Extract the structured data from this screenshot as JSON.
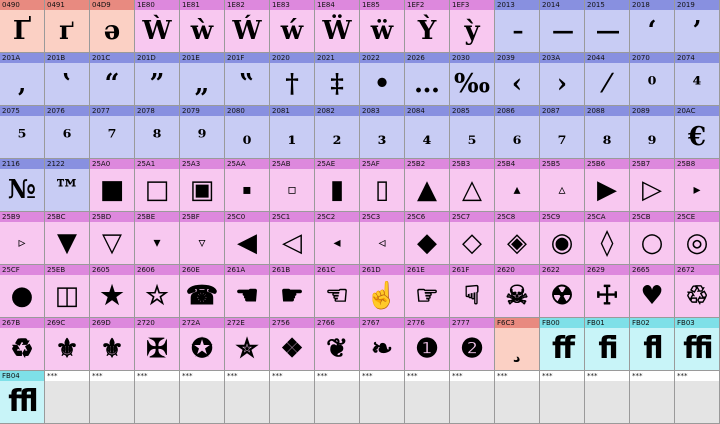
{
  "grid": {
    "cells": [
      {
        "code": "0490",
        "glyph": "Ґ",
        "cat": "cyrillic"
      },
      {
        "code": "0491",
        "glyph": "ґ",
        "cat": "cyrillic"
      },
      {
        "code": "04D9",
        "glyph": "ә",
        "cat": "cyrillic"
      },
      {
        "code": "1E80",
        "glyph": "Ẁ",
        "cat": "latin"
      },
      {
        "code": "1E81",
        "glyph": "ẁ",
        "cat": "latin"
      },
      {
        "code": "1E82",
        "glyph": "Ẃ",
        "cat": "latin"
      },
      {
        "code": "1E83",
        "glyph": "ẃ",
        "cat": "latin"
      },
      {
        "code": "1E84",
        "glyph": "Ẅ",
        "cat": "latin"
      },
      {
        "code": "1E85",
        "glyph": "ẅ",
        "cat": "latin"
      },
      {
        "code": "1EF2",
        "glyph": "Ỳ",
        "cat": "latin"
      },
      {
        "code": "1EF3",
        "glyph": "ỳ",
        "cat": "latin"
      },
      {
        "code": "2013",
        "glyph": "–",
        "cat": "punct"
      },
      {
        "code": "2014",
        "glyph": "—",
        "cat": "punct"
      },
      {
        "code": "2015",
        "glyph": "―",
        "cat": "punct"
      },
      {
        "code": "2018",
        "glyph": "‘",
        "cat": "punct"
      },
      {
        "code": "2019",
        "glyph": "’",
        "cat": "punct"
      },
      {
        "code": "201A",
        "glyph": "‚",
        "cat": "punct"
      },
      {
        "code": "201B",
        "glyph": "‛",
        "cat": "punct"
      },
      {
        "code": "201C",
        "glyph": "“",
        "cat": "punct"
      },
      {
        "code": "201D",
        "glyph": "”",
        "cat": "punct"
      },
      {
        "code": "201E",
        "glyph": "„",
        "cat": "punct"
      },
      {
        "code": "201F",
        "glyph": "‟",
        "cat": "punct"
      },
      {
        "code": "2020",
        "glyph": "†",
        "cat": "punct"
      },
      {
        "code": "2021",
        "glyph": "‡",
        "cat": "punct"
      },
      {
        "code": "2022",
        "glyph": "•",
        "cat": "punct"
      },
      {
        "code": "2026",
        "glyph": "…",
        "cat": "punct"
      },
      {
        "code": "2030",
        "glyph": "‰",
        "cat": "punct"
      },
      {
        "code": "2039",
        "glyph": "‹",
        "cat": "punct"
      },
      {
        "code": "203A",
        "glyph": "›",
        "cat": "punct"
      },
      {
        "code": "2044",
        "glyph": "⁄",
        "cat": "punct"
      },
      {
        "code": "2070",
        "glyph": "⁰",
        "cat": "punct"
      },
      {
        "code": "2074",
        "glyph": "⁴",
        "cat": "punct"
      },
      {
        "code": "2075",
        "glyph": "⁵",
        "cat": "punct"
      },
      {
        "code": "2076",
        "glyph": "⁶",
        "cat": "punct"
      },
      {
        "code": "2077",
        "glyph": "⁷",
        "cat": "punct"
      },
      {
        "code": "2078",
        "glyph": "⁸",
        "cat": "punct"
      },
      {
        "code": "2079",
        "glyph": "⁹",
        "cat": "punct"
      },
      {
        "code": "2080",
        "glyph": "₀",
        "cat": "punct"
      },
      {
        "code": "2081",
        "glyph": "₁",
        "cat": "punct"
      },
      {
        "code": "2082",
        "glyph": "₂",
        "cat": "punct"
      },
      {
        "code": "2083",
        "glyph": "₃",
        "cat": "punct"
      },
      {
        "code": "2084",
        "glyph": "₄",
        "cat": "punct"
      },
      {
        "code": "2085",
        "glyph": "₅",
        "cat": "punct"
      },
      {
        "code": "2086",
        "glyph": "₆",
        "cat": "punct"
      },
      {
        "code": "2087",
        "glyph": "₇",
        "cat": "punct"
      },
      {
        "code": "2088",
        "glyph": "₈",
        "cat": "punct"
      },
      {
        "code": "2089",
        "glyph": "₉",
        "cat": "punct"
      },
      {
        "code": "20AC",
        "glyph": "€",
        "cat": "punct"
      },
      {
        "code": "2116",
        "glyph": "№",
        "cat": "punct"
      },
      {
        "code": "2122",
        "glyph": "™",
        "cat": "punct"
      },
      {
        "code": "25A0",
        "glyph": "■",
        "cat": "symbol"
      },
      {
        "code": "25A1",
        "glyph": "□",
        "cat": "symbol"
      },
      {
        "code": "25A3",
        "glyph": "▣",
        "cat": "symbol"
      },
      {
        "code": "25AA",
        "glyph": "▪",
        "cat": "symbol"
      },
      {
        "code": "25AB",
        "glyph": "▫",
        "cat": "symbol"
      },
      {
        "code": "25AE",
        "glyph": "▮",
        "cat": "symbol"
      },
      {
        "code": "25AF",
        "glyph": "▯",
        "cat": "symbol"
      },
      {
        "code": "25B2",
        "glyph": "▲",
        "cat": "symbol"
      },
      {
        "code": "25B3",
        "glyph": "△",
        "cat": "symbol"
      },
      {
        "code": "25B4",
        "glyph": "▴",
        "cat": "symbol"
      },
      {
        "code": "25B5",
        "glyph": "▵",
        "cat": "symbol"
      },
      {
        "code": "25B6",
        "glyph": "▶",
        "cat": "symbol"
      },
      {
        "code": "25B7",
        "glyph": "▷",
        "cat": "symbol"
      },
      {
        "code": "25B8",
        "glyph": "▸",
        "cat": "symbol"
      },
      {
        "code": "25B9",
        "glyph": "▹",
        "cat": "symbol"
      },
      {
        "code": "25BC",
        "glyph": "▼",
        "cat": "symbol"
      },
      {
        "code": "25BD",
        "glyph": "▽",
        "cat": "symbol"
      },
      {
        "code": "25BE",
        "glyph": "▾",
        "cat": "symbol"
      },
      {
        "code": "25BF",
        "glyph": "▿",
        "cat": "symbol"
      },
      {
        "code": "25C0",
        "glyph": "◀",
        "cat": "symbol"
      },
      {
        "code": "25C1",
        "glyph": "◁",
        "cat": "symbol"
      },
      {
        "code": "25C2",
        "glyph": "◂",
        "cat": "symbol"
      },
      {
        "code": "25C3",
        "glyph": "◃",
        "cat": "symbol"
      },
      {
        "code": "25C6",
        "glyph": "◆",
        "cat": "symbol"
      },
      {
        "code": "25C7",
        "glyph": "◇",
        "cat": "symbol"
      },
      {
        "code": "25C8",
        "glyph": "◈",
        "cat": "symbol"
      },
      {
        "code": "25C9",
        "glyph": "◉",
        "cat": "symbol"
      },
      {
        "code": "25CA",
        "glyph": "◊",
        "cat": "symbol"
      },
      {
        "code": "25CB",
        "glyph": "○",
        "cat": "symbol"
      },
      {
        "code": "25CE",
        "glyph": "◎",
        "cat": "symbol"
      },
      {
        "code": "25CF",
        "glyph": "●",
        "cat": "symbol"
      },
      {
        "code": "25EB",
        "glyph": "◫",
        "cat": "symbol"
      },
      {
        "code": "2605",
        "glyph": "★",
        "cat": "symbol"
      },
      {
        "code": "2606",
        "glyph": "☆",
        "cat": "symbol"
      },
      {
        "code": "260E",
        "glyph": "☎",
        "cat": "symbol"
      },
      {
        "code": "261A",
        "glyph": "☚",
        "cat": "symbol"
      },
      {
        "code": "261B",
        "glyph": "☛",
        "cat": "symbol"
      },
      {
        "code": "261C",
        "glyph": "☜",
        "cat": "symbol"
      },
      {
        "code": "261D",
        "glyph": "☝",
        "cat": "symbol"
      },
      {
        "code": "261E",
        "glyph": "☞",
        "cat": "symbol"
      },
      {
        "code": "261F",
        "glyph": "☟",
        "cat": "symbol"
      },
      {
        "code": "2620",
        "glyph": "☠",
        "cat": "symbol"
      },
      {
        "code": "2622",
        "glyph": "☢",
        "cat": "symbol"
      },
      {
        "code": "2629",
        "glyph": "☩",
        "cat": "symbol"
      },
      {
        "code": "2665",
        "glyph": "♥",
        "cat": "symbol"
      },
      {
        "code": "2672",
        "glyph": "♲",
        "cat": "symbol"
      },
      {
        "code": "267B",
        "glyph": "♻",
        "cat": "symbol"
      },
      {
        "code": "269C",
        "glyph": "⚜",
        "cat": "symbol"
      },
      {
        "code": "269D",
        "glyph": "⚜",
        "cat": "symbol"
      },
      {
        "code": "2720",
        "glyph": "✠",
        "cat": "symbol"
      },
      {
        "code": "272A",
        "glyph": "✪",
        "cat": "symbol"
      },
      {
        "code": "272E",
        "glyph": "✮",
        "cat": "symbol"
      },
      {
        "code": "2756",
        "glyph": "❖",
        "cat": "symbol"
      },
      {
        "code": "2766",
        "glyph": "❦",
        "cat": "symbol"
      },
      {
        "code": "2767",
        "glyph": "❧",
        "cat": "symbol"
      },
      {
        "code": "2776",
        "glyph": "❶",
        "cat": "symbol"
      },
      {
        "code": "2777",
        "glyph": "❷",
        "cat": "symbol"
      },
      {
        "code": "F6C3",
        "glyph": "¸",
        "cat": "private"
      },
      {
        "code": "FB00",
        "glyph": "ff",
        "cat": "alpha"
      },
      {
        "code": "FB01",
        "glyph": "fi",
        "cat": "alpha"
      },
      {
        "code": "FB02",
        "glyph": "fl",
        "cat": "alpha"
      },
      {
        "code": "FB03",
        "glyph": "ffi",
        "cat": "alpha"
      },
      {
        "code": "FB04",
        "glyph": "ffl",
        "cat": "alpha"
      },
      {
        "code": "***",
        "glyph": "",
        "cat": "empty"
      },
      {
        "code": "***",
        "glyph": "",
        "cat": "empty"
      },
      {
        "code": "***",
        "glyph": "",
        "cat": "empty"
      },
      {
        "code": "***",
        "glyph": "",
        "cat": "empty"
      },
      {
        "code": "***",
        "glyph": "",
        "cat": "empty"
      },
      {
        "code": "***",
        "glyph": "",
        "cat": "empty"
      },
      {
        "code": "***",
        "glyph": "",
        "cat": "empty"
      },
      {
        "code": "***",
        "glyph": "",
        "cat": "empty"
      },
      {
        "code": "***",
        "glyph": "",
        "cat": "empty"
      },
      {
        "code": "***",
        "glyph": "",
        "cat": "empty"
      },
      {
        "code": "***",
        "glyph": "",
        "cat": "empty"
      },
      {
        "code": "***",
        "glyph": "",
        "cat": "empty"
      },
      {
        "code": "***",
        "glyph": "",
        "cat": "empty"
      },
      {
        "code": "***",
        "glyph": "",
        "cat": "empty"
      },
      {
        "code": "***",
        "glyph": "",
        "cat": "empty"
      }
    ]
  }
}
